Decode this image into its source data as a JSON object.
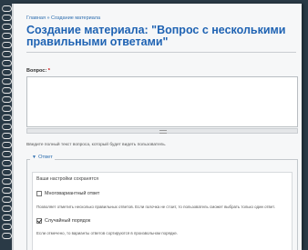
{
  "breadcrumb": "Главная » Создание материала",
  "page_title": "Создание материала: \"Вопрос с несколькими правильными ответами\"",
  "question_field": {
    "label": "Вопрос:",
    "required_mark": "*",
    "value": "",
    "help": "Введите полный текст вопроса, который будет видеть пользователь."
  },
  "answer_section": {
    "legend": "Ответ",
    "saved_note": "Ваши настройки сохранятся",
    "multiple_answer": {
      "label": "Многовариантный ответ",
      "checked": false,
      "description": "Позволяет отметить несколько правильных ответов. Если галочка не стоит, то пользователь сможет выбрать только один ответ."
    },
    "random_order": {
      "label": "Случайный порядок",
      "checked": true,
      "description": "Если отмечено, то варианты ответов сортируются в произвольном порядке."
    }
  }
}
